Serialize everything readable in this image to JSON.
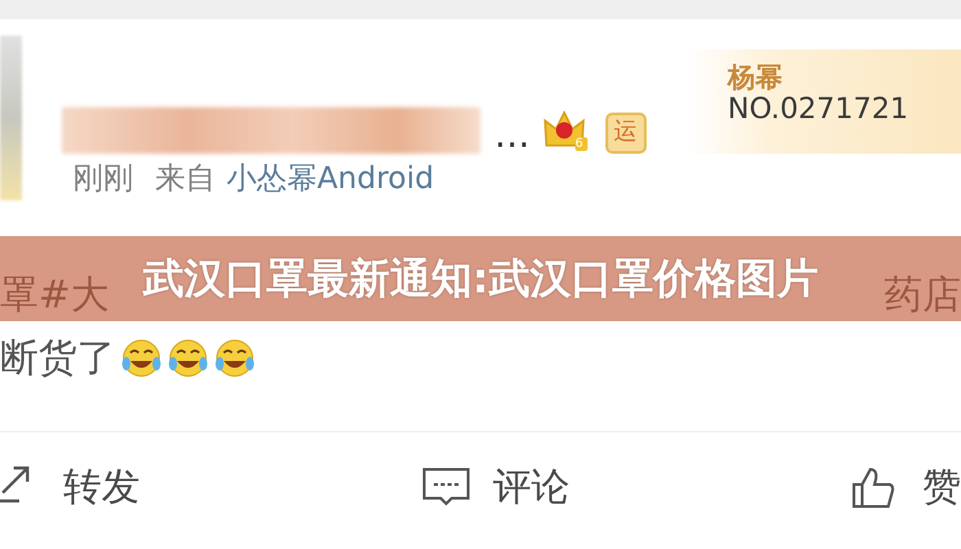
{
  "post": {
    "author_ellipsis": "…",
    "badges": [
      {
        "kind": "crown",
        "text": "6"
      },
      {
        "kind": "tag",
        "text": "运"
      }
    ],
    "fan_badge": {
      "name": "杨幂",
      "number": "NO.0271721"
    },
    "time": "刚刚",
    "source_label": "来自",
    "source": "小怂幂Android",
    "text_left": "罩#大",
    "text_right": "药店",
    "text_line2": "断货了",
    "emoji_count_icons": [
      {
        "kind": "laugh-cry"
      },
      {
        "kind": "laugh-cry"
      },
      {
        "kind": "laugh-cry"
      }
    ]
  },
  "banner": {
    "title": "武汉口罩最新通知:武汉口罩价格图片"
  },
  "actions": [
    {
      "kind": "share",
      "label": "转发"
    },
    {
      "kind": "comment",
      "label": "评论"
    },
    {
      "kind": "like",
      "label": "赞"
    }
  ]
}
